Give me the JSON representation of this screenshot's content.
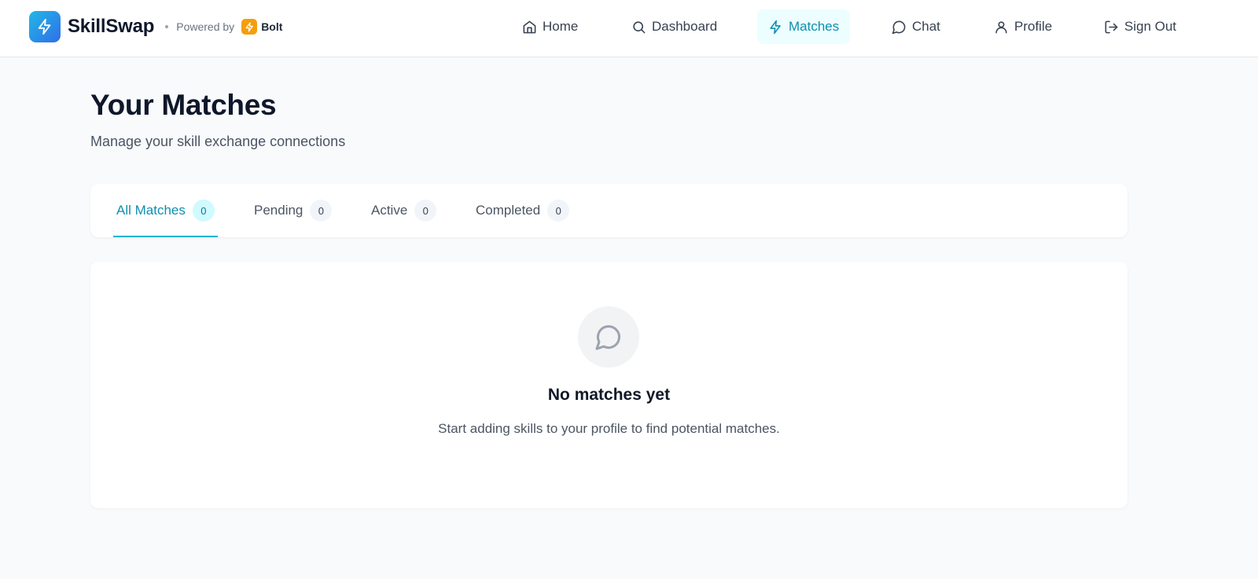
{
  "brand": {
    "name": "SkillSwap",
    "powered_by": "Powered by",
    "partner": "Bolt"
  },
  "nav": {
    "home": "Home",
    "dashboard": "Dashboard",
    "matches": "Matches",
    "chat": "Chat",
    "profile": "Profile",
    "sign_out": "Sign Out",
    "active": "matches"
  },
  "page": {
    "title": "Your Matches",
    "subtitle": "Manage your skill exchange connections"
  },
  "tabs": [
    {
      "label": "All Matches",
      "count": "0",
      "active": true
    },
    {
      "label": "Pending",
      "count": "0",
      "active": false
    },
    {
      "label": "Active",
      "count": "0",
      "active": false
    },
    {
      "label": "Completed",
      "count": "0",
      "active": false
    }
  ],
  "empty_state": {
    "icon": "message-circle-icon",
    "title": "No matches yet",
    "text": "Start adding skills to your profile to find potential matches."
  },
  "colors": {
    "accent": "#0e8fb0",
    "accent_bg": "#ecfeff",
    "brand_gradient_start": "#22b8e6",
    "brand_gradient_end": "#2f6ee8",
    "bolt": "#f59e0b"
  }
}
